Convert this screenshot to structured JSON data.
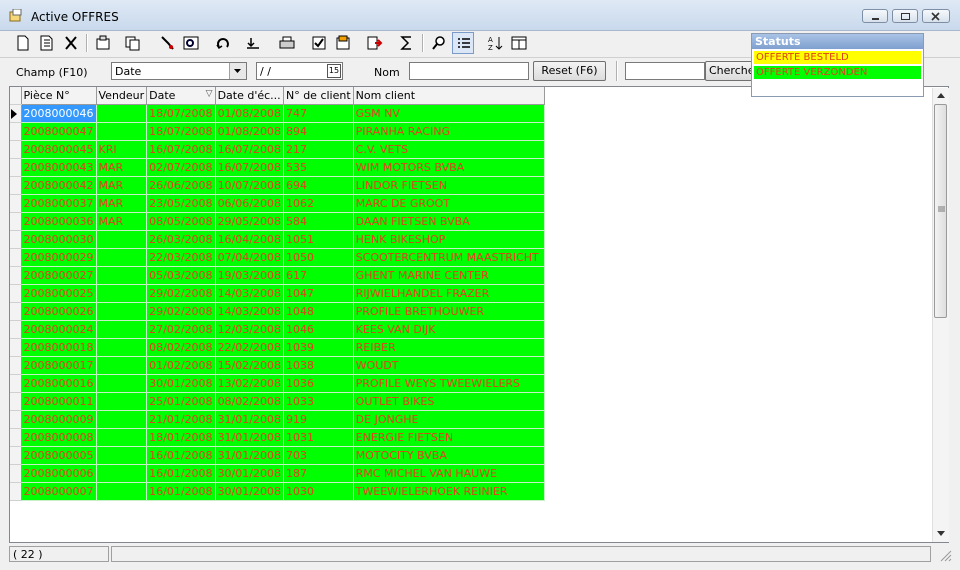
{
  "window": {
    "title": "Active OFFRES"
  },
  "toolbar": {
    "buttons": [
      "new-icon",
      "edit-icon",
      "delete-icon",
      "properties-icon",
      "copy-icon",
      "filter-icon",
      "find-icon",
      "refresh-icon",
      "import-icon",
      "print-icon",
      "checklist-icon",
      "report-icon",
      "export-icon",
      "sum-icon",
      "zoom-icon",
      "list-view-icon",
      "sort-icon",
      "layout-icon"
    ]
  },
  "filter": {
    "field_label": "Champ (F10)",
    "field_value": "Date",
    "date_value": " / /",
    "calendar_label": "15",
    "name_label": "Nom",
    "name_value": "",
    "reset_label": "Reset (F6)",
    "search_value": "",
    "search_label": "Chercher"
  },
  "legend": {
    "title": "Statuts",
    "items": [
      {
        "label": "OFFERTE BESTELD",
        "color": "#ffff00"
      },
      {
        "label": "OFFERTE VERZONDEN",
        "color": "#00ff00"
      }
    ]
  },
  "grid": {
    "columns": [
      "Pièce N°",
      "Vendeur",
      "Date",
      "Date d'éc...",
      "N° de client",
      "Nom client"
    ],
    "sort_indicator": "▽",
    "rows": [
      [
        "2008000046",
        "",
        "18/07/2008",
        "01/08/2008",
        "747",
        "GSM NV"
      ],
      [
        "2008000047",
        "",
        "18/07/2008",
        "01/08/2008",
        "894",
        "PIRANHA RACING"
      ],
      [
        "2008000045",
        "KRI",
        "16/07/2008",
        "16/07/2008",
        "217",
        "C.V. VETS"
      ],
      [
        "2008000043",
        "MAR",
        "02/07/2008",
        "16/07/2008",
        "535",
        "WIM MOTORS BVBA"
      ],
      [
        "2008000042",
        "MAR",
        "26/06/2008",
        "10/07/2008",
        "694",
        "LINDOR FIETSEN"
      ],
      [
        "2008000037",
        "MAR",
        "23/05/2008",
        "06/06/2008",
        "1062",
        "MARC DE GROOT"
      ],
      [
        "2008000036",
        "MAR",
        "08/05/2008",
        "29/05/2008",
        "584",
        "DAAN FIETSEN BVBA"
      ],
      [
        "2008000030",
        "",
        "26/03/2008",
        "16/04/2008",
        "1051",
        "HENK BIKESHOP"
      ],
      [
        "2008000029",
        "",
        "22/03/2008",
        "07/04/2008",
        "1050",
        "SCOOTERCENTRUM MAASTRICHT"
      ],
      [
        "2008000027",
        "",
        "05/03/2008",
        "19/03/2008",
        "617",
        "GHENT MARINE CENTER"
      ],
      [
        "2008000025",
        "",
        "29/02/2008",
        "14/03/2008",
        "1047",
        "RIJWIELHANDEL FRAZER"
      ],
      [
        "2008000026",
        "",
        "29/02/2008",
        "14/03/2008",
        "1048",
        "PROFILE BRETHOUWER"
      ],
      [
        "2008000024",
        "",
        "27/02/2008",
        "12/03/2008",
        "1046",
        "KEES VAN DIJK"
      ],
      [
        "2008000018",
        "",
        "08/02/2008",
        "22/02/2008",
        "1039",
        "REIBER"
      ],
      [
        "2008000017",
        "",
        "01/02/2008",
        "15/02/2008",
        "1038",
        "WOUDT"
      ],
      [
        "2008000016",
        "",
        "30/01/2008",
        "13/02/2008",
        "1036",
        "PROFILE WEYS TWEEWIELERS"
      ],
      [
        "2008000011",
        "",
        "25/01/2008",
        "08/02/2008",
        "1033",
        "OUTLET BIKES"
      ],
      [
        "2008000009",
        "",
        "21/01/2008",
        "31/01/2008",
        "919",
        "DE JONGHE"
      ],
      [
        "2008000008",
        "",
        "18/01/2008",
        "31/01/2008",
        "1031",
        "ENERGIE FIETSEN"
      ],
      [
        "2008000005",
        "",
        "16/01/2008",
        "31/01/2008",
        "703",
        "MOTOCITY BVBA"
      ],
      [
        "2008000006",
        "",
        "16/01/2008",
        "30/01/2008",
        "187",
        "RMC MICHEL VAN HAUWE"
      ],
      [
        "2008000007",
        "",
        "16/01/2008",
        "30/01/2008",
        "1030",
        "TWEEWIELERHOEK REINIER"
      ]
    ]
  },
  "status": {
    "count": "( 22 )",
    "message": ""
  }
}
